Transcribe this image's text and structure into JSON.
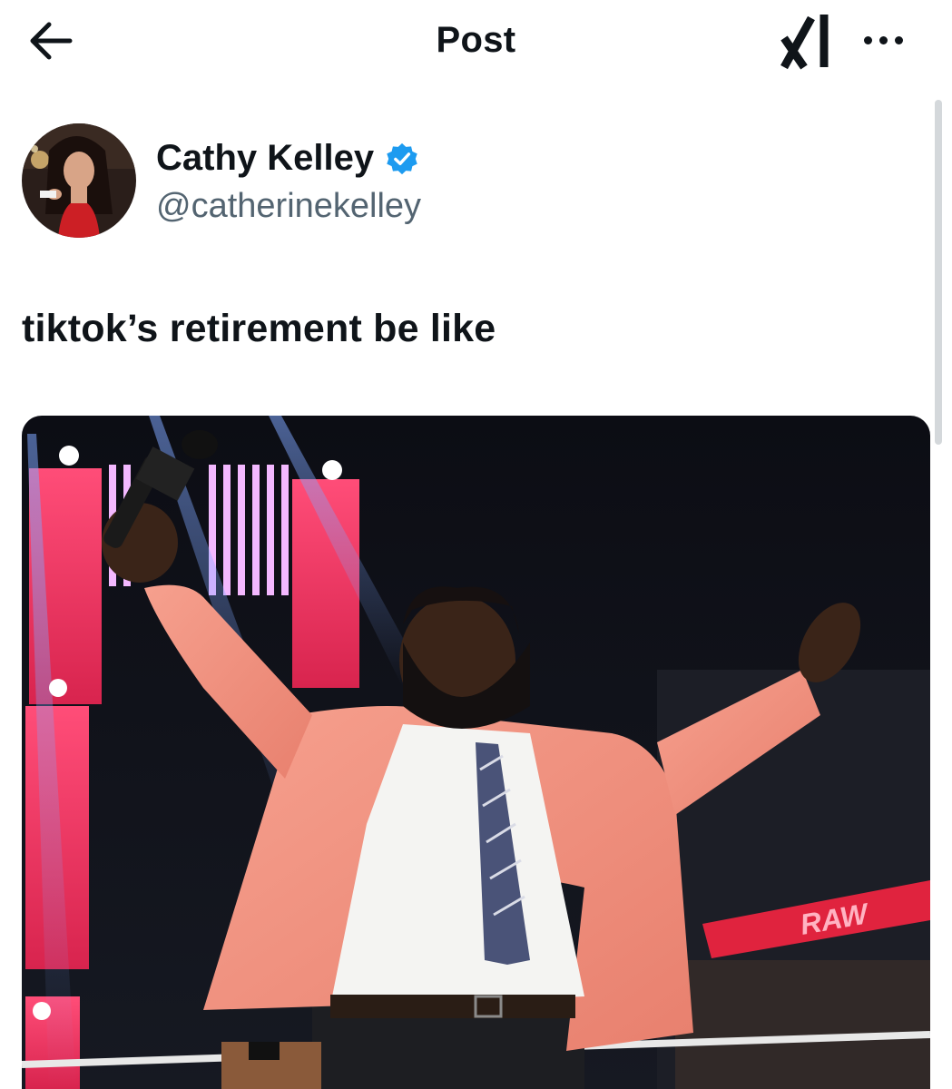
{
  "header": {
    "title": "Post",
    "back_icon": "arrow-left-icon",
    "grok_icon": "grok-icon",
    "more_icon": "more-horizontal-icon"
  },
  "author": {
    "display_name": "Cathy Kelley",
    "handle": "@catherinekelley",
    "verified": true,
    "verified_color": "#1d9bf0"
  },
  "post": {
    "text": "tiktok’s retirement be like"
  },
  "media": {
    "logo_text": "RAW"
  },
  "colors": {
    "text_primary": "#0f1419",
    "text_secondary": "#536471",
    "background": "#ffffff"
  }
}
